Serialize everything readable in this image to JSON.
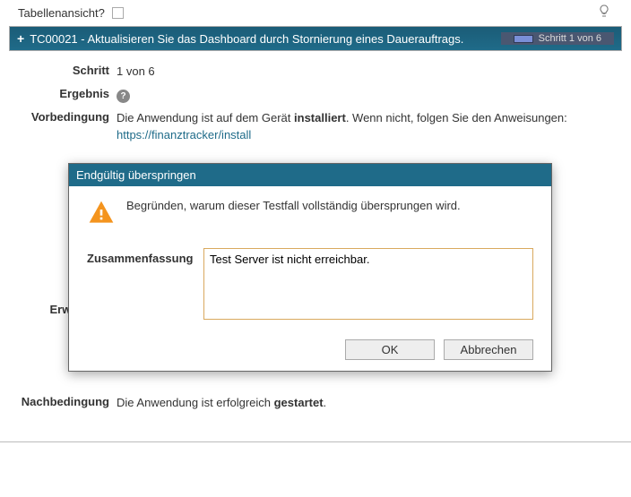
{
  "topbar": {
    "table_view_label": "Tabellenansicht?",
    "bulb_icon": "bulb-icon"
  },
  "tc_header": {
    "plus": "+",
    "title": "TC00021 - Aktualisieren Sie das Dashboard durch Stornierung eines Dauerauftrags.",
    "step_badge": "Schritt 1 von 6"
  },
  "fields": {
    "step_label": "Schritt",
    "step_value": "1 von 6",
    "result_label": "Ergebnis",
    "precondition_label": "Vorbedingung",
    "precondition_text_pre": "Die Anwendung ist auf dem Gerät ",
    "precondition_bold": "installiert",
    "precondition_text_post": ". Wenn nicht, folgen Sie den Anweisungen: ",
    "precondition_link": "https://finanztracker/install",
    "expected_label": "Erwartetes",
    "postcondition_label": "Nachbedingung",
    "postcondition_text_pre": "Die Anwendung ist erfolgreich ",
    "postcondition_bold": "gestartet",
    "postcondition_text_post": "."
  },
  "modal": {
    "title": "Endgültig überspringen",
    "message": "Begründen, warum dieser Testfall vollständig übersprungen wird.",
    "summary_label": "Zusammenfassung",
    "summary_value": "Test Server ist nicht erreichbar.",
    "ok_label": "OK",
    "cancel_label": "Abbrechen"
  }
}
